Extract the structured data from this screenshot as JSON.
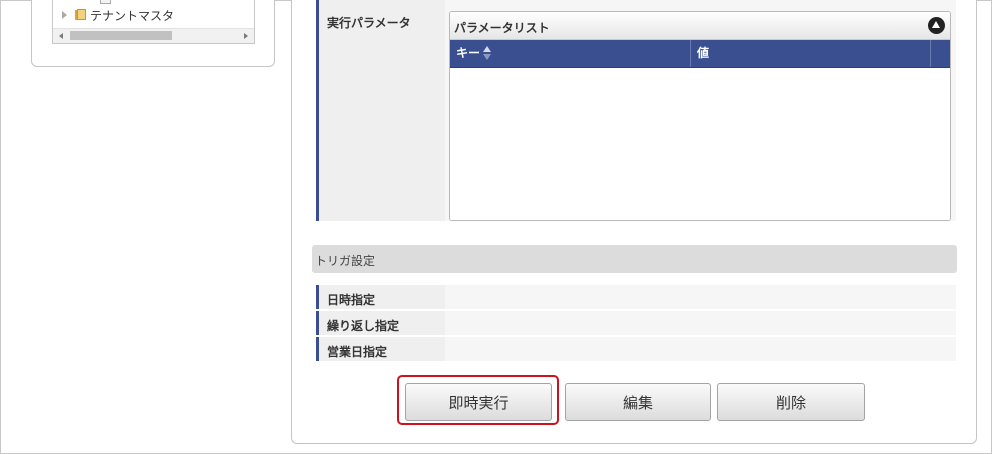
{
  "tree": {
    "items": [
      {
        "label": "テナントマスタ",
        "icon": "folder-icon"
      }
    ],
    "scroll_left_icon": "scroll-left-arrow",
    "scroll_right_icon": "scroll-right-arrow"
  },
  "params": {
    "label": "実行パラメータ",
    "list_title": "パラメータリスト",
    "columns": [
      "キー",
      "値"
    ],
    "rows": []
  },
  "trigger": {
    "section_title": "トリガ設定",
    "rows": [
      {
        "label": "日時指定",
        "value": ""
      },
      {
        "label": "繰り返し指定",
        "value": ""
      },
      {
        "label": "営業日指定",
        "value": ""
      }
    ]
  },
  "actions": {
    "run_now": "即時実行",
    "edit": "編集",
    "delete": "削除"
  },
  "colors": {
    "header_blue": "#3a4f8f",
    "highlight_red": "#d0101b"
  }
}
